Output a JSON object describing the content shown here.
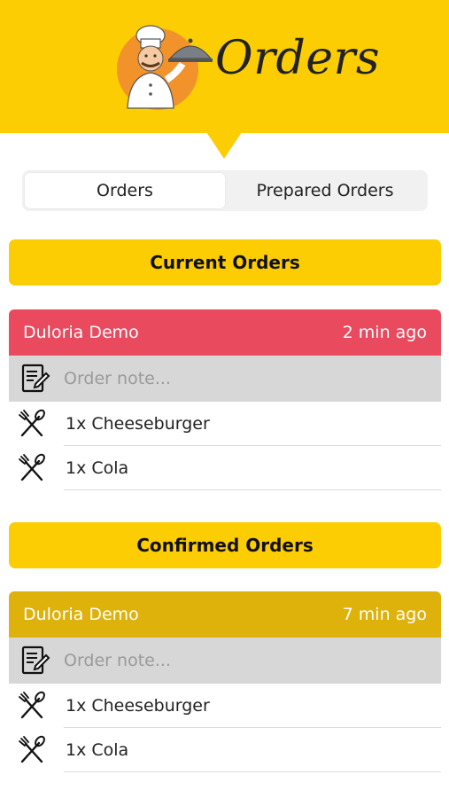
{
  "header": {
    "title": "Orders",
    "logo": "chef-with-cloche-icon",
    "background": "#fccd02"
  },
  "tabs": [
    {
      "label": "Orders",
      "active": true
    },
    {
      "label": "Prepared Orders",
      "active": false
    }
  ],
  "sections": [
    {
      "title": "Current Orders",
      "order": {
        "customer": "Duloria Demo",
        "time": "2 min ago",
        "header_color": "#e94a5e",
        "note_placeholder": "Order note...",
        "items": [
          {
            "text": "1x Cheeseburger",
            "icon": "fork-knife-icon"
          },
          {
            "text": "1x Cola",
            "icon": "fork-knife-icon"
          }
        ]
      }
    },
    {
      "title": "Confirmed Orders",
      "order": {
        "customer": "Duloria Demo",
        "time": "7 min ago",
        "header_color": "#deb10b",
        "note_placeholder": "Order note...",
        "items": [
          {
            "text": "1x Cheeseburger",
            "icon": "fork-knife-icon"
          },
          {
            "text": "1x Cola",
            "icon": "fork-knife-icon"
          }
        ]
      }
    }
  ]
}
